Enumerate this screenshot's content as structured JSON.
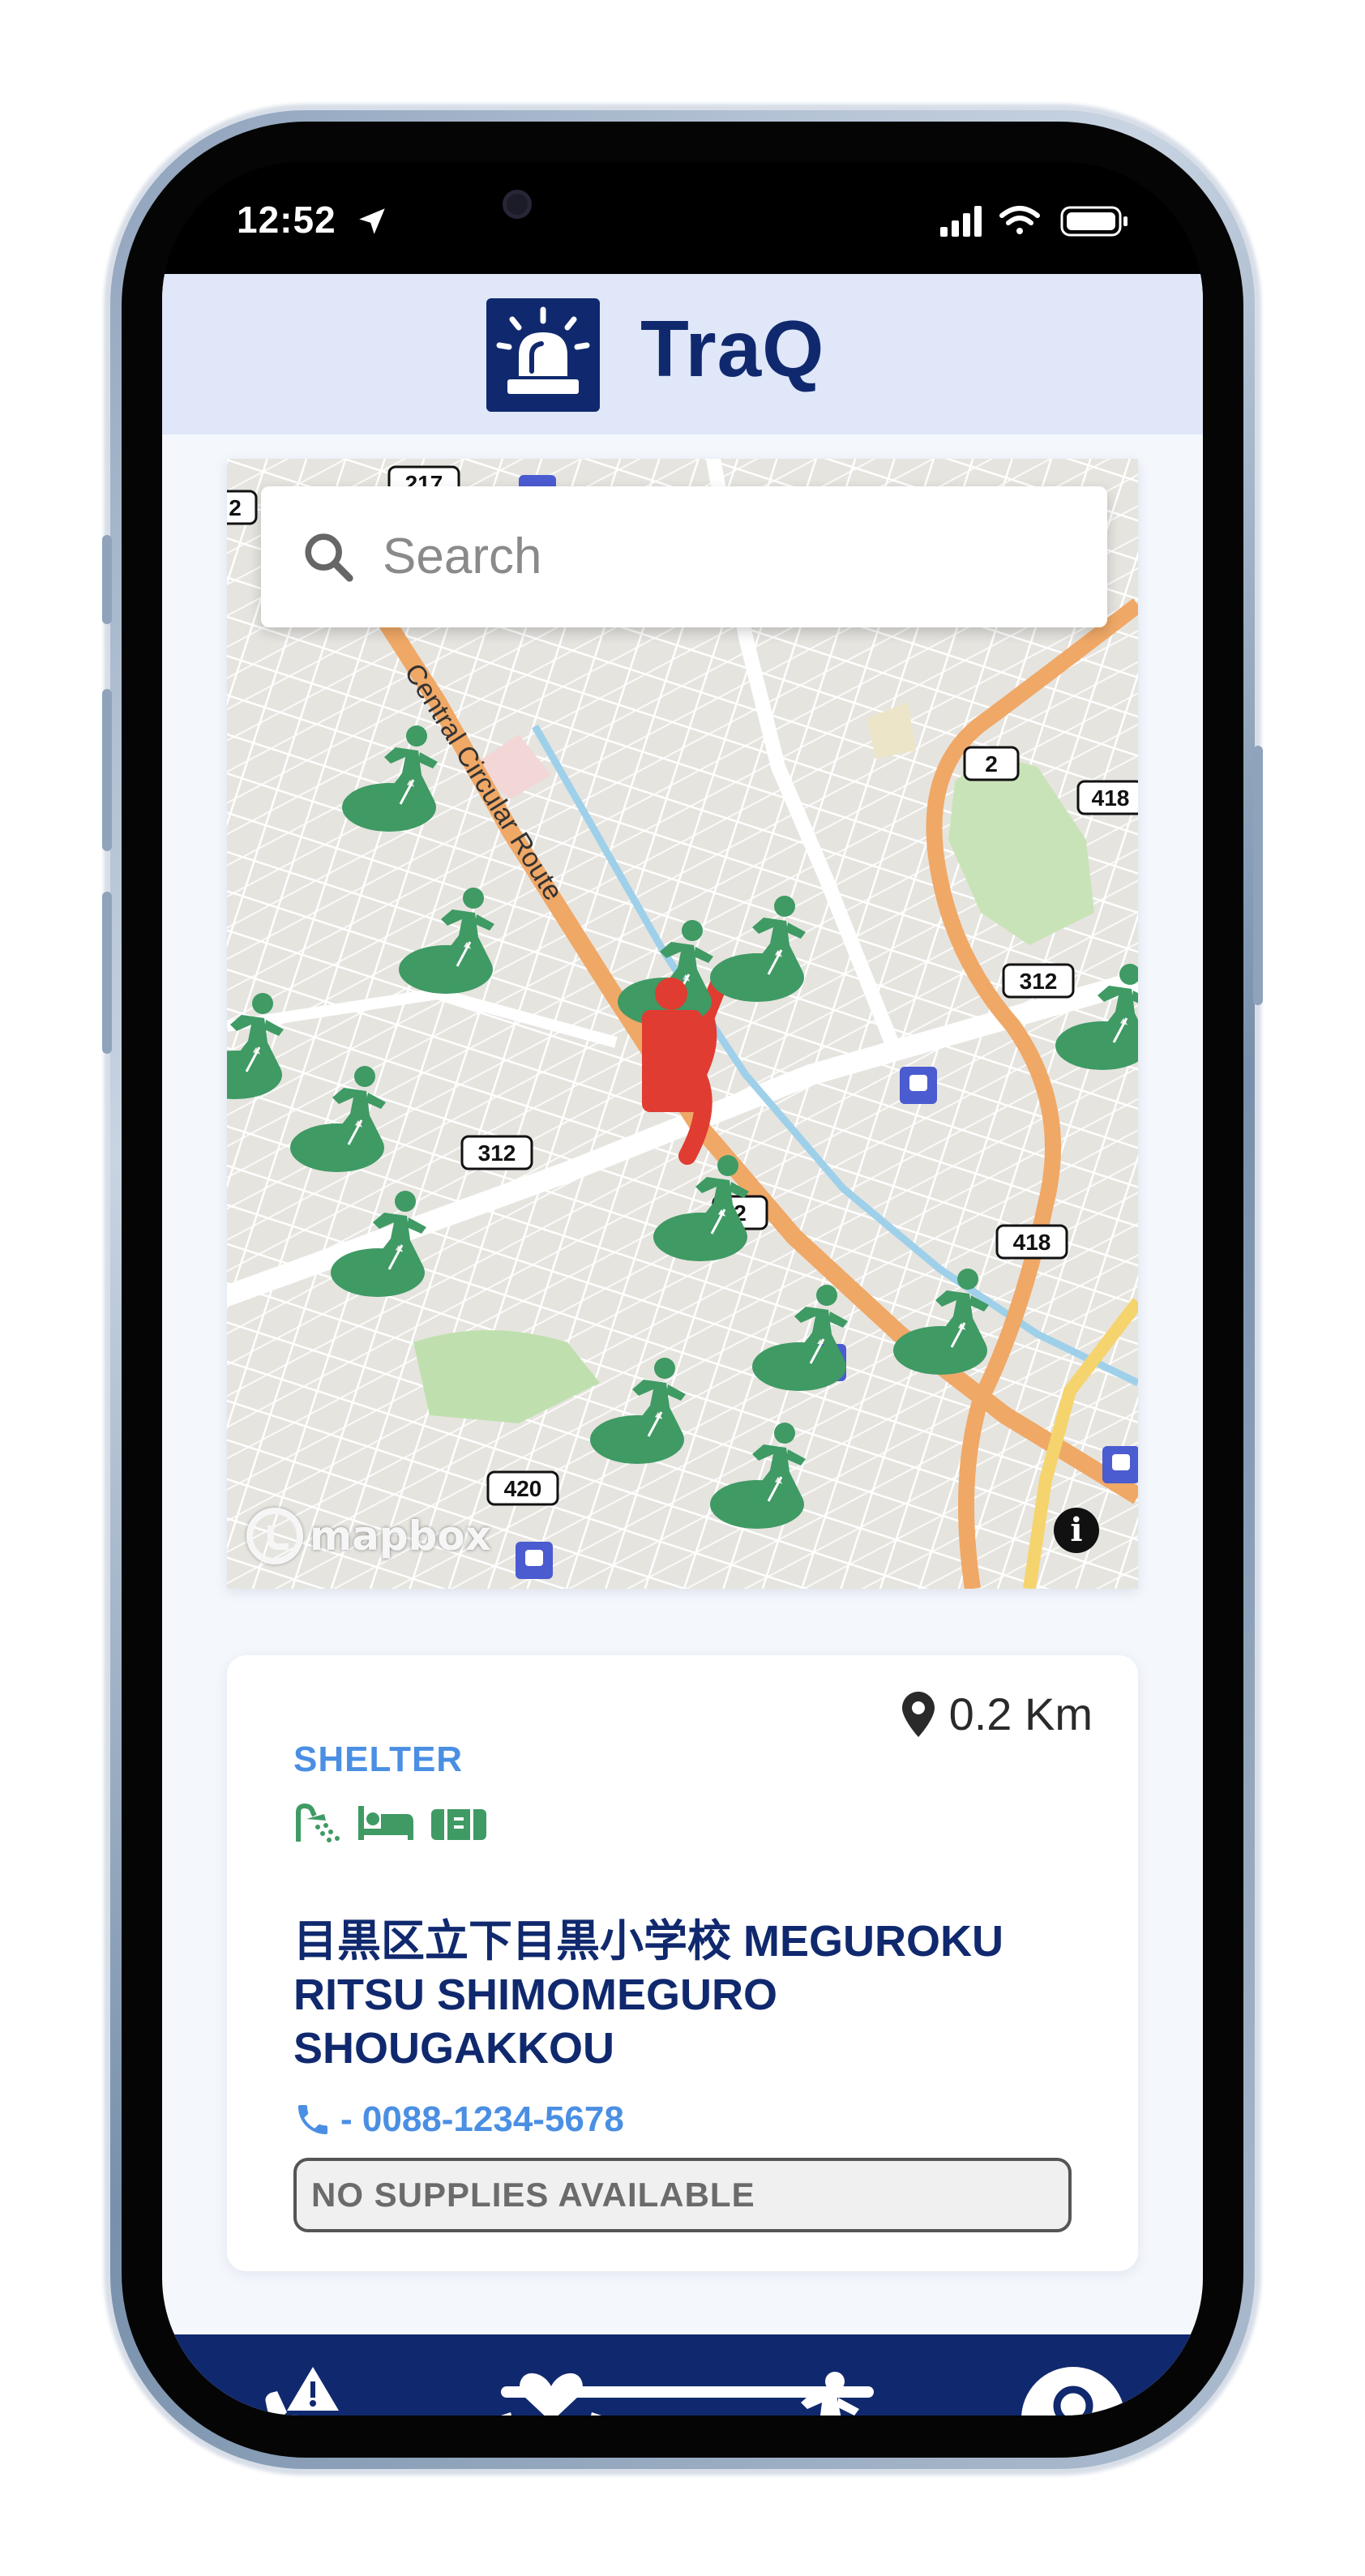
{
  "status_bar": {
    "time": "12:52",
    "icons": [
      "location-arrow-icon",
      "signal-bars-icon",
      "wifi-icon",
      "battery-icon"
    ]
  },
  "header": {
    "title": "TraQ",
    "logo_icon": "siren-icon"
  },
  "map": {
    "search_placeholder": "Search",
    "attribution": "mapbox",
    "road_labels": [
      "217",
      "2",
      "Central Circular Route",
      "2",
      "418",
      "312",
      "312",
      "2",
      "418",
      "420"
    ],
    "markers": {
      "shelter_icon": "evacuation-runner-icon",
      "user_icon": "person-pin-icon",
      "route_color": "#e03c31"
    }
  },
  "shelter_card": {
    "distance": "0.2 Km",
    "type": "SHELTER",
    "amenities": [
      "shower-icon",
      "bed-icon",
      "supplies-box-icon"
    ],
    "name": "目黒区立下目黒小学校 MEGUROKU RITSU SHIMOMEGURO SHOUGAKKOU",
    "phone": "- 0088-1234-5678",
    "supplies_status": "NO SUPPLIES AVAILABLE"
  },
  "bottom_nav": {
    "items": [
      {
        "icon": "emergency-call-icon",
        "active": false
      },
      {
        "icon": "care-hands-heart-icon",
        "active": true
      },
      {
        "icon": "evacuation-icon",
        "active": false
      },
      {
        "icon": "profile-icon",
        "active": false
      }
    ]
  },
  "colors": {
    "brand_navy": "#10296e",
    "accent_blue": "#4a8fe3",
    "shelter_green": "#3f9a64",
    "route_red": "#e03c31",
    "header_bg": "#dfe7f8"
  }
}
